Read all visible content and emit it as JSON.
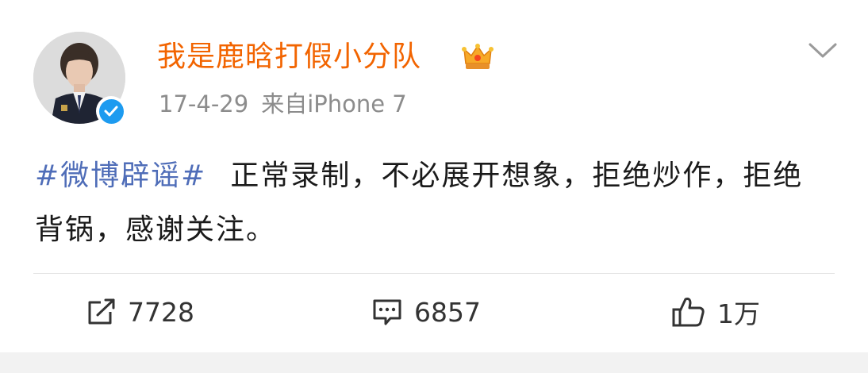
{
  "post": {
    "username": "我是鹿晗打假小分队",
    "date": "17-4-29",
    "source_prefix": "来自",
    "source_device": "iPhone 7",
    "hashtag": "#微博辟谣#",
    "text": "正常录制，不必展开想象，拒绝炒作，拒绝背锅，感谢关注。"
  },
  "actions": {
    "repost_count": "7728",
    "comment_count": "6857",
    "like_count": "1万"
  },
  "icons": {
    "avatar": "user-avatar",
    "verified": "verified-badge-icon",
    "crown": "crown-badge-icon",
    "menu": "chevron-down-icon",
    "repost": "repost-icon",
    "comment": "comment-icon",
    "like": "thumbs-up-icon"
  },
  "colors": {
    "username": "#f26400",
    "hashtag": "#4f6db8",
    "meta": "#8c8c8c",
    "verified": "#1d9bf0"
  }
}
